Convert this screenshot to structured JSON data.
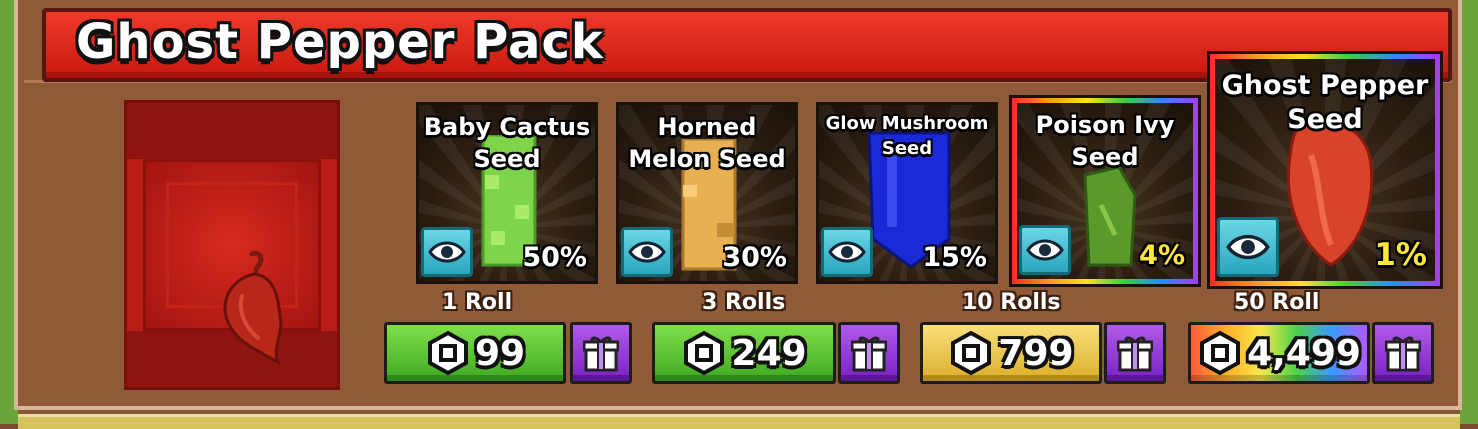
{
  "pack": {
    "title": "Ghost Pepper Pack",
    "icon": "ghost-pepper-icon"
  },
  "seeds": [
    {
      "name": "Baby Cactus Seed",
      "line1": "Baby Cactus",
      "line2": "Seed",
      "chance": "50%",
      "color": "#7ed44a",
      "rarity_border": "none"
    },
    {
      "name": "Horned Melon Seed",
      "line1": "Horned",
      "line2": "Melon Seed",
      "chance": "30%",
      "color": "#e8b050",
      "rarity_border": "none"
    },
    {
      "name": "Glow Mushroom Seed",
      "line1": "Glow Mushroom",
      "line2": "Seed",
      "chance": "15%",
      "color": "#1a2ad8",
      "rarity_border": "none"
    },
    {
      "name": "Poison Ivy Seed",
      "line1": "Poison Ivy",
      "line2": "Seed",
      "chance": "4%",
      "color": "#5a9a2a",
      "rarity_border": "rainbow"
    },
    {
      "name": "Ghost Pepper Seed",
      "line1": "Ghost Pepper",
      "line2": "Seed",
      "chance": "1%",
      "color": "#d8442a",
      "rarity_border": "rainbow"
    }
  ],
  "purchases": [
    {
      "label": "1 Roll",
      "price": "99",
      "style": "green"
    },
    {
      "label": "3 Rolls",
      "price": "249",
      "style": "green"
    },
    {
      "label": "10 Rolls",
      "price": "799",
      "style": "gold"
    },
    {
      "label": "50 Roll",
      "price": "4,499",
      "style": "rainbow"
    }
  ],
  "icons": {
    "view": "eye-icon",
    "currency": "robux-icon",
    "gift": "gift-icon"
  }
}
